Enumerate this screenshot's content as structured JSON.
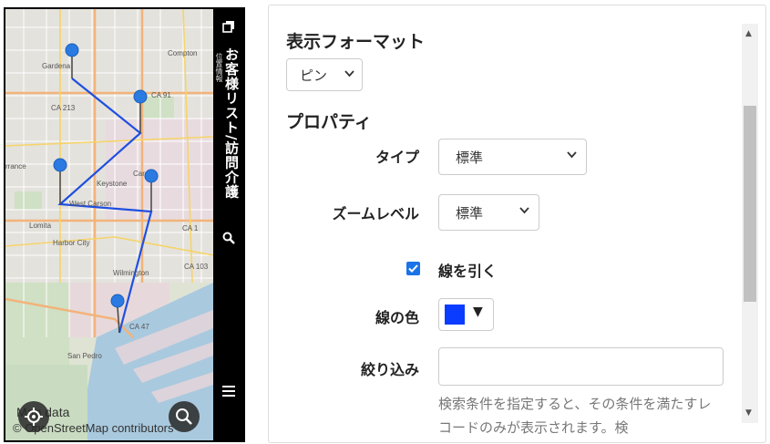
{
  "map": {
    "labels": {
      "gardena": "Gardena",
      "compton": "Compton",
      "carson": "Carson",
      "west_carson": "West Carson",
      "keystone": "Keystone",
      "lomita": "Lomita",
      "harbor_city": "Harbor City",
      "wilmington": "Wilmington",
      "san_pedro": "San Pedro",
      "torrance": "rrance",
      "ca213": "CA 213",
      "ca91": "CA 91",
      "ca47": "CA 47",
      "ca1": "CA 1",
      "ca103": "CA 103"
    },
    "attribution_title": "Map data",
    "attribution": "© OpenStreetMap contributors",
    "route_color": "#1f4fe0",
    "pin_color": "#2a7ae2"
  },
  "sidebar": {
    "title": "お客様リスト/訪問介護",
    "subtitle": "位置情報"
  },
  "panel": {
    "display_format": {
      "heading": "表示フォーマット",
      "value": "ピン"
    },
    "properties": {
      "heading": "プロパティ",
      "type": {
        "label": "タイプ",
        "value": "標準"
      },
      "zoom": {
        "label": "ズームレベル",
        "value": "標準"
      },
      "draw_line": {
        "label": "線を引く",
        "checked": true
      },
      "line_color": {
        "label": "線の色",
        "value": "#0a3cff"
      },
      "filter": {
        "label": "絞り込み",
        "value": "",
        "help": "検索条件を指定すると、その条件を満たすレコードのみが表示されます。検"
      }
    },
    "accent_color": "#1a73e8"
  }
}
